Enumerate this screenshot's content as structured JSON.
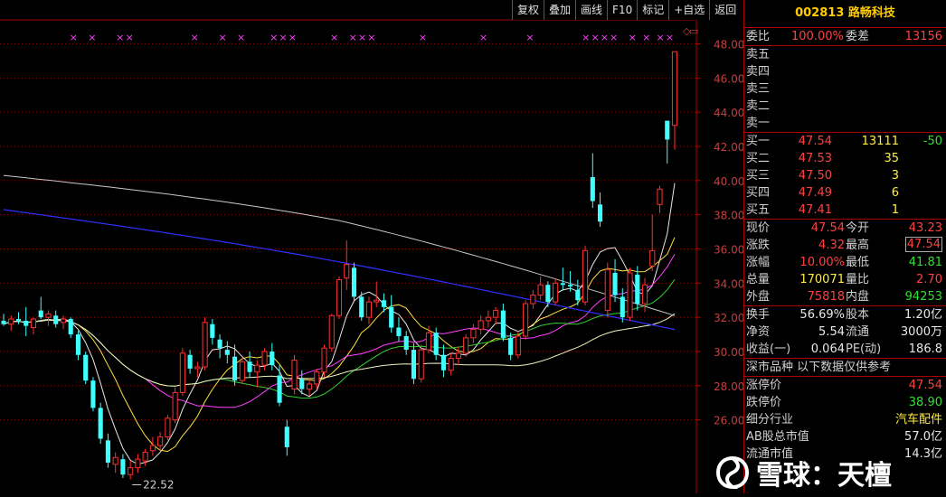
{
  "toolbar": [
    "复权",
    "叠加",
    "画线",
    "F10",
    "标记",
    "+自选",
    "返回"
  ],
  "price_axis": [
    "48.00",
    "46.00",
    "44.00",
    "42.00",
    "40.00",
    "38.00",
    "36.00",
    "34.00",
    "32.00",
    "30.00",
    "28.00",
    "26.00"
  ],
  "low_label": "22.52",
  "mark_glyph": "×",
  "corner_glyphs": [
    "◇",
    "▭"
  ],
  "candles": [
    [
      31.8,
      32.2,
      31.5,
      31.6
    ],
    [
      31.6,
      32.1,
      31.2,
      31.9
    ],
    [
      31.9,
      32.3,
      31.6,
      31.8
    ],
    [
      31.8,
      32.6,
      30.9,
      31.5
    ],
    [
      31.4,
      32.0,
      31.0,
      31.9
    ],
    [
      32.4,
      33.2,
      31.9,
      32.0
    ],
    [
      32.0,
      32.4,
      31.5,
      32.2
    ],
    [
      32.1,
      32.4,
      31.4,
      31.6
    ],
    [
      31.7,
      32.1,
      31.3,
      31.9
    ],
    [
      31.9,
      32.0,
      30.8,
      31.0
    ],
    [
      31.0,
      31.2,
      29.5,
      29.8
    ],
    [
      29.8,
      30.0,
      28.1,
      28.3
    ],
    [
      28.3,
      28.5,
      26.5,
      26.7
    ],
    [
      26.7,
      27.0,
      24.6,
      24.9
    ],
    [
      24.8,
      25.2,
      23.2,
      23.5
    ],
    [
      23.4,
      24.1,
      22.9,
      23.8
    ],
    [
      23.7,
      24.0,
      22.6,
      22.8
    ],
    [
      22.8,
      23.6,
      22.52,
      23.2
    ],
    [
      23.2,
      24.0,
      22.9,
      23.7
    ],
    [
      23.6,
      24.3,
      23.3,
      24.1
    ],
    [
      24.2,
      25.0,
      23.9,
      24.5
    ],
    [
      24.5,
      25.3,
      24.2,
      25.0
    ],
    [
      25.0,
      26.3,
      24.8,
      26.1
    ],
    [
      26.0,
      27.9,
      25.8,
      27.6
    ],
    [
      27.6,
      30.2,
      27.4,
      29.9
    ],
    [
      29.8,
      30.1,
      28.7,
      29.0
    ],
    [
      29.0,
      29.4,
      28.5,
      29.1
    ],
    [
      29.1,
      32.0,
      28.9,
      31.7
    ],
    [
      31.6,
      31.9,
      30.4,
      30.8
    ],
    [
      30.7,
      31.0,
      29.6,
      30.2
    ],
    [
      30.1,
      30.6,
      29.3,
      29.8
    ],
    [
      29.7,
      30.4,
      28.0,
      28.3
    ],
    [
      28.3,
      29.6,
      28.1,
      29.4
    ],
    [
      29.4,
      30.0,
      28.5,
      28.8
    ],
    [
      28.8,
      29.5,
      27.9,
      29.2
    ],
    [
      29.2,
      30.2,
      28.9,
      30.0
    ],
    [
      30.0,
      30.5,
      28.9,
      29.2
    ],
    [
      28.6,
      29.2,
      26.8,
      27.0
    ],
    [
      25.6,
      26.0,
      23.9,
      24.4
    ],
    [
      27.8,
      29.8,
      27.5,
      29.5
    ],
    [
      28.4,
      28.9,
      27.5,
      27.8
    ],
    [
      27.8,
      28.4,
      27.4,
      28.1
    ],
    [
      28.1,
      29.0,
      27.8,
      28.8
    ],
    [
      28.8,
      30.4,
      28.5,
      30.2
    ],
    [
      30.2,
      32.2,
      30.0,
      32.1
    ],
    [
      32.1,
      34.4,
      31.9,
      34.2
    ],
    [
      34.3,
      36.5,
      33.6,
      35.1
    ],
    [
      34.9,
      35.2,
      32.9,
      33.2
    ],
    [
      33.2,
      33.5,
      31.8,
      32.0
    ],
    [
      32.0,
      33.2,
      31.6,
      32.9
    ],
    [
      32.9,
      34.1,
      32.6,
      33.0
    ],
    [
      33.0,
      33.4,
      32.3,
      32.6
    ],
    [
      32.6,
      33.3,
      31.1,
      31.4
    ],
    [
      31.4,
      32.0,
      30.6,
      30.9
    ],
    [
      30.9,
      31.2,
      29.8,
      30.1
    ],
    [
      30.1,
      30.5,
      28.1,
      28.4
    ],
    [
      28.4,
      30.4,
      28.2,
      30.1
    ],
    [
      30.1,
      31.5,
      29.9,
      31.1
    ],
    [
      31.1,
      31.4,
      29.5,
      29.8
    ],
    [
      29.8,
      30.4,
      28.5,
      28.9
    ],
    [
      28.9,
      29.9,
      28.6,
      29.6
    ],
    [
      29.6,
      30.3,
      29.2,
      29.9
    ],
    [
      29.9,
      31.0,
      29.7,
      30.8
    ],
    [
      30.8,
      31.6,
      30.5,
      31.3
    ],
    [
      31.3,
      32.1,
      31.0,
      31.8
    ],
    [
      31.8,
      32.4,
      31.4,
      32.0
    ],
    [
      32.0,
      32.6,
      31.6,
      32.4
    ],
    [
      32.4,
      32.8,
      30.6,
      30.8
    ],
    [
      30.8,
      31.1,
      29.5,
      29.8
    ],
    [
      29.8,
      31.2,
      29.6,
      30.9
    ],
    [
      30.9,
      33.0,
      30.7,
      32.8
    ],
    [
      32.8,
      33.6,
      32.5,
      33.3
    ],
    [
      33.3,
      34.4,
      33.0,
      33.9
    ],
    [
      33.9,
      34.1,
      32.6,
      32.9
    ],
    [
      32.9,
      34.3,
      32.7,
      34.0
    ],
    [
      34.0,
      34.9,
      33.6,
      33.9
    ],
    [
      33.9,
      34.7,
      33.5,
      33.8
    ],
    [
      33.6,
      34.2,
      32.7,
      33.0
    ],
    [
      32.9,
      36.2,
      32.7,
      35.9
    ],
    [
      40.2,
      41.6,
      38.4,
      38.8
    ],
    [
      38.6,
      39.3,
      37.3,
      37.6
    ],
    [
      32.4,
      35.2,
      32.0,
      34.8
    ],
    [
      34.6,
      35.4,
      32.9,
      33.3
    ],
    [
      33.2,
      33.7,
      31.7,
      32.0
    ],
    [
      32.0,
      34.9,
      31.8,
      34.6
    ],
    [
      34.5,
      35.0,
      32.4,
      32.8
    ],
    [
      32.8,
      34.3,
      32.3,
      33.9
    ],
    [
      35.0,
      38.0,
      34.7,
      35.9
    ],
    [
      38.6,
      39.7,
      38.1,
      39.5
    ],
    [
      43.5,
      43.5,
      41.0,
      42.4
    ],
    [
      43.23,
      47.54,
      41.81,
      47.54
    ]
  ],
  "marks": [
    15,
    19,
    25,
    27,
    41,
    47,
    51,
    58,
    60,
    62,
    71,
    75,
    77,
    79,
    90,
    103,
    113,
    125,
    127,
    129,
    131,
    135,
    138,
    141,
    143
  ],
  "panel": {
    "title": "002813 路畅科技",
    "webi": {
      "label": "委比",
      "value": "100.00%",
      "label2": "委差",
      "value2": "13156"
    },
    "sells": [
      "卖五",
      "卖四",
      "卖三",
      "卖二",
      "卖一"
    ],
    "buys": [
      {
        "label": "买一",
        "price": "47.54",
        "vol": "13111",
        "chg": "-50"
      },
      {
        "label": "买二",
        "price": "47.53",
        "vol": "35",
        "chg": ""
      },
      {
        "label": "买三",
        "price": "47.50",
        "vol": "3",
        "chg": ""
      },
      {
        "label": "买四",
        "price": "47.49",
        "vol": "6",
        "chg": ""
      },
      {
        "label": "买五",
        "price": "47.41",
        "vol": "1",
        "chg": ""
      }
    ],
    "stats1": [
      {
        "l1": "现价",
        "v1": "47.54",
        "c1": "red",
        "l2": "今开",
        "v2": "43.23",
        "c2": "red"
      },
      {
        "l1": "涨跌",
        "v1": "4.32",
        "c1": "red",
        "l2": "最高",
        "v2": "47.54",
        "c2": "red"
      },
      {
        "l1": "涨幅",
        "v1": "10.00%",
        "c1": "red",
        "l2": "最低",
        "v2": "41.81",
        "c2": "grn"
      },
      {
        "l1": "总量",
        "v1": "170071",
        "c1": "yel",
        "l2": "量比",
        "v2": "2.70",
        "c2": "red"
      },
      {
        "l1": "外盘",
        "v1": "75818",
        "c1": "red",
        "l2": "内盘",
        "v2": "94253",
        "c2": "grn"
      }
    ],
    "stats2": [
      {
        "l1": "换手",
        "v1": "56.69%",
        "l2": "股本",
        "v2": "1.20亿"
      },
      {
        "l1": "净资",
        "v1": "5.54",
        "l2": "流通",
        "v2": "3000万"
      },
      {
        "l1": "收益(一)",
        "v1": "0.064",
        "l2": "PE(动)",
        "v2": "186.8"
      }
    ],
    "section_title": "深市品种  以下数据仅供参考",
    "limit_up": {
      "label": "涨停价",
      "value": "47.54"
    },
    "limit_down": {
      "label": "跌停价",
      "value": "38.90"
    },
    "industry": {
      "label": "细分行业",
      "value": "汽车配件"
    },
    "ab_cap": {
      "label": "AB股总市值",
      "value": "57.0亿"
    },
    "circ_cap": {
      "label": "流通市值",
      "value": "14.3亿"
    }
  },
  "watermark": "雪球：天檀"
}
